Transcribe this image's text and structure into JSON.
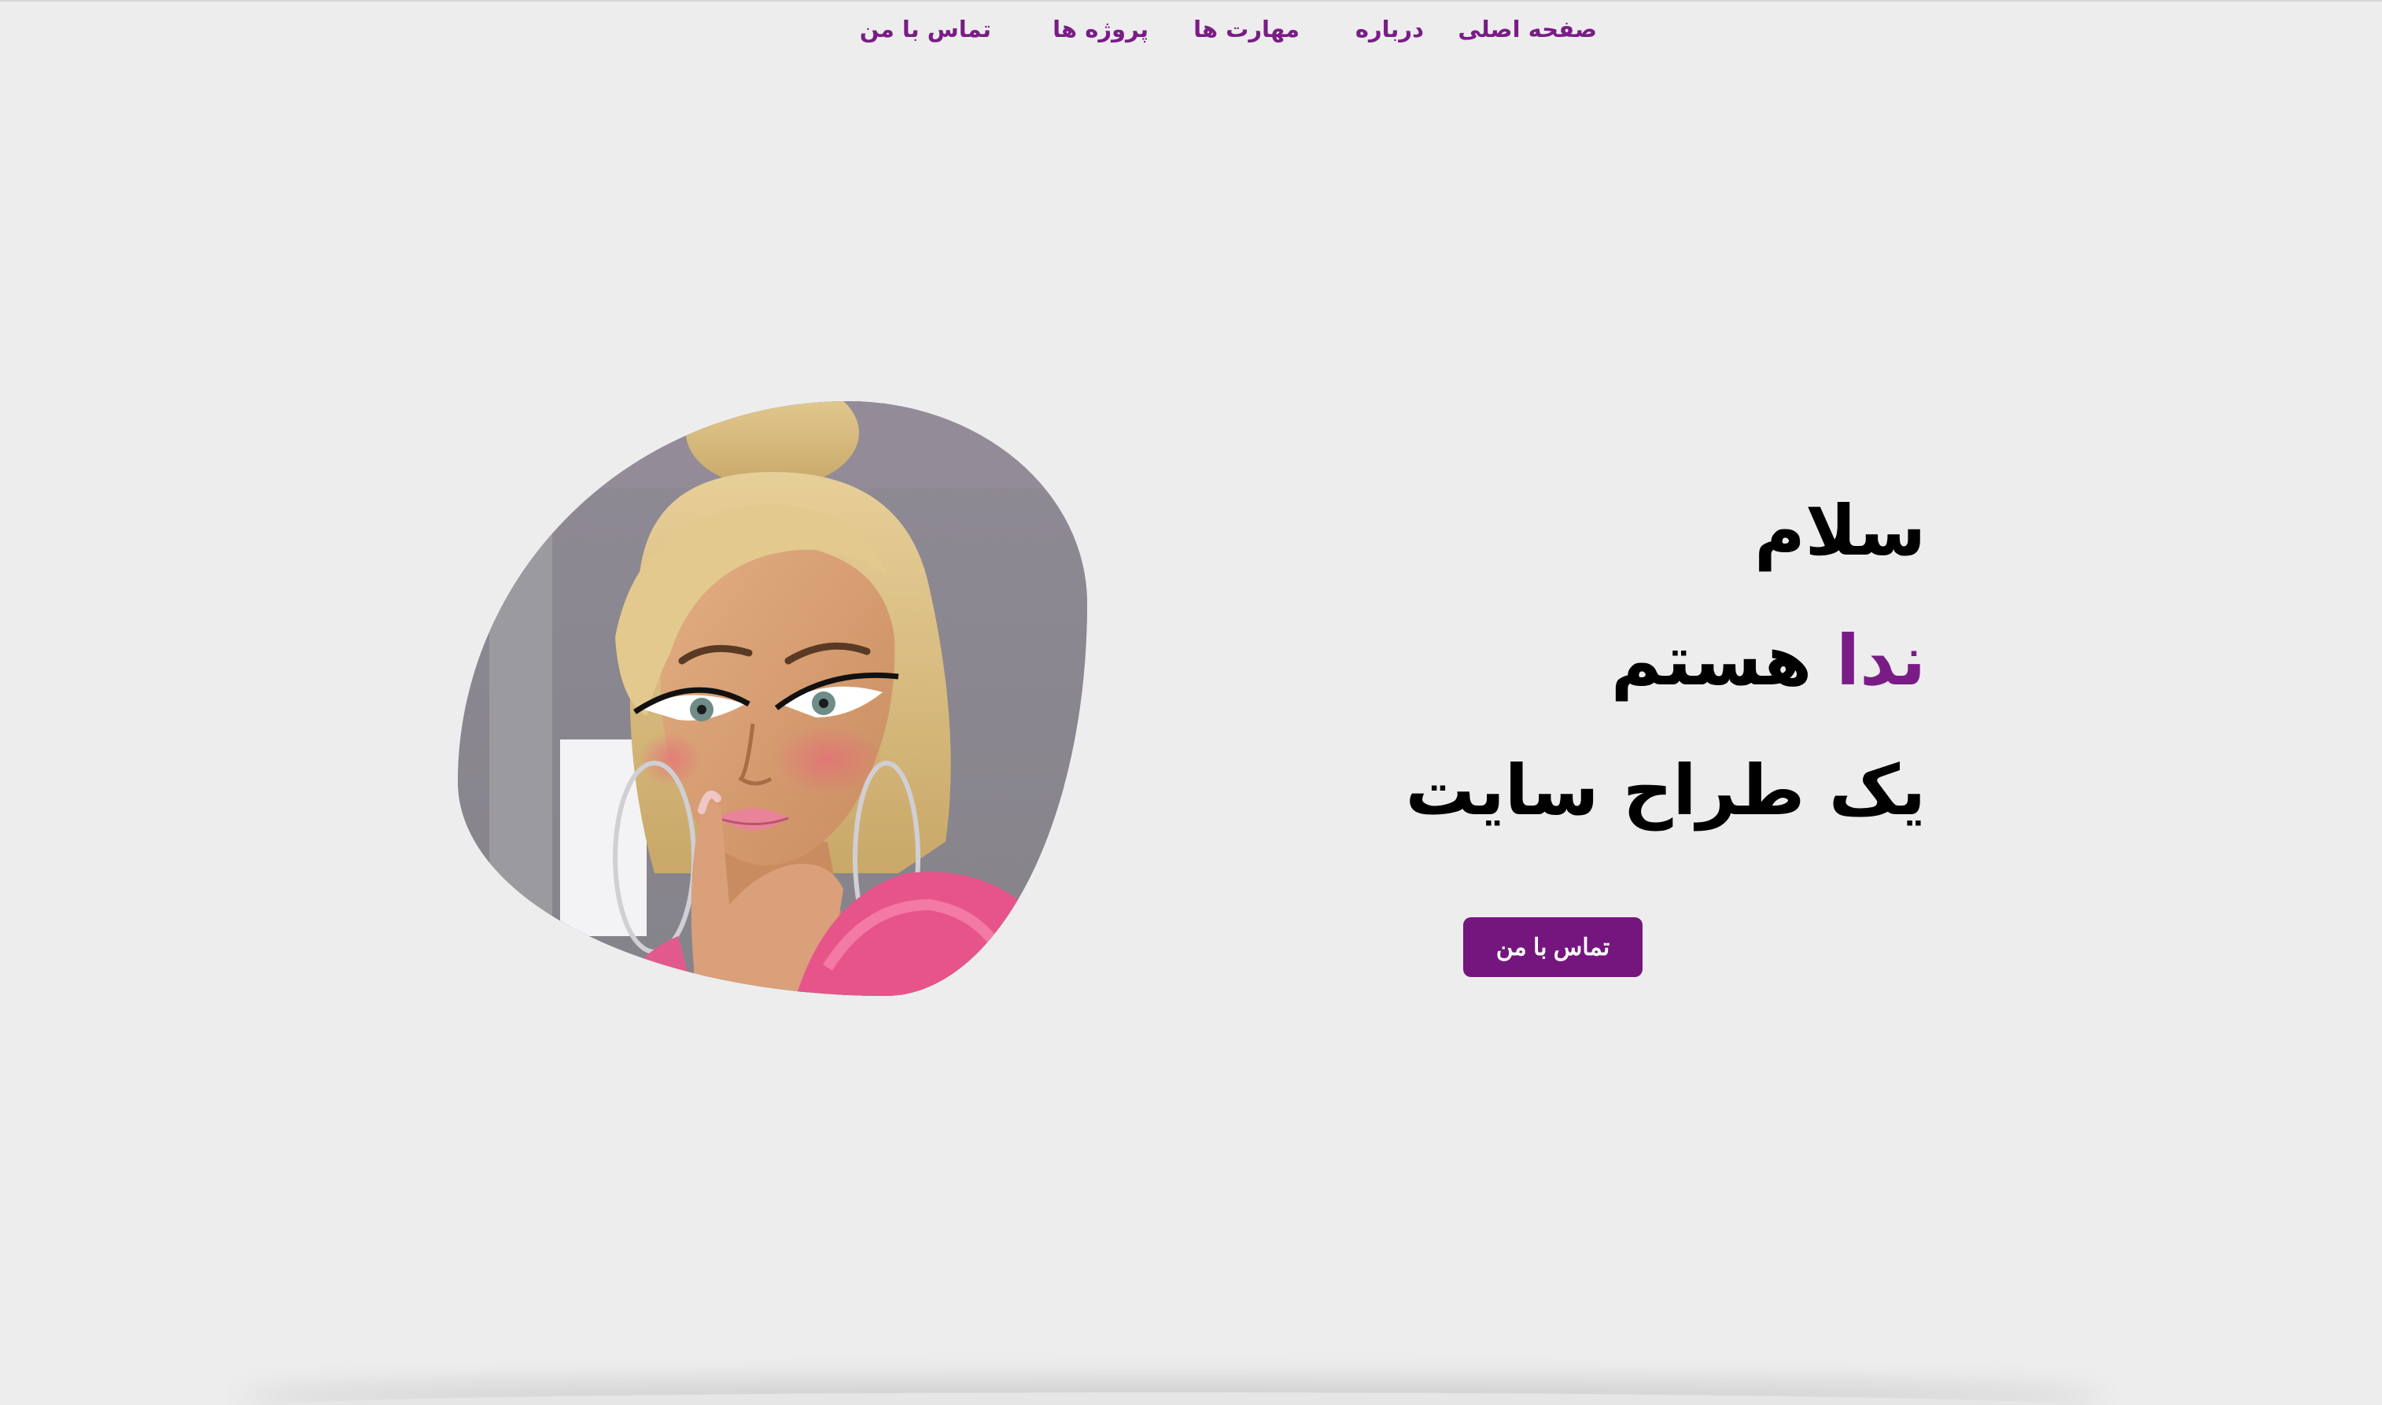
{
  "nav": {
    "items": [
      {
        "label": "صفحه اصلی"
      },
      {
        "label": "درباره"
      },
      {
        "label": "مهارت ها"
      },
      {
        "label": "پروژه ها"
      },
      {
        "label": "تماس با من"
      }
    ]
  },
  "hero": {
    "greeting": "سلام",
    "name": "ندا",
    "name_suffix": "هستم",
    "role": "یک طراح سایت",
    "cta_label": "تماس با من",
    "portrait_icon": "portrait-illustration"
  },
  "colors": {
    "accent": "#7a1c86",
    "button": "#75167f",
    "background": "#ededed",
    "text": "#000000"
  }
}
